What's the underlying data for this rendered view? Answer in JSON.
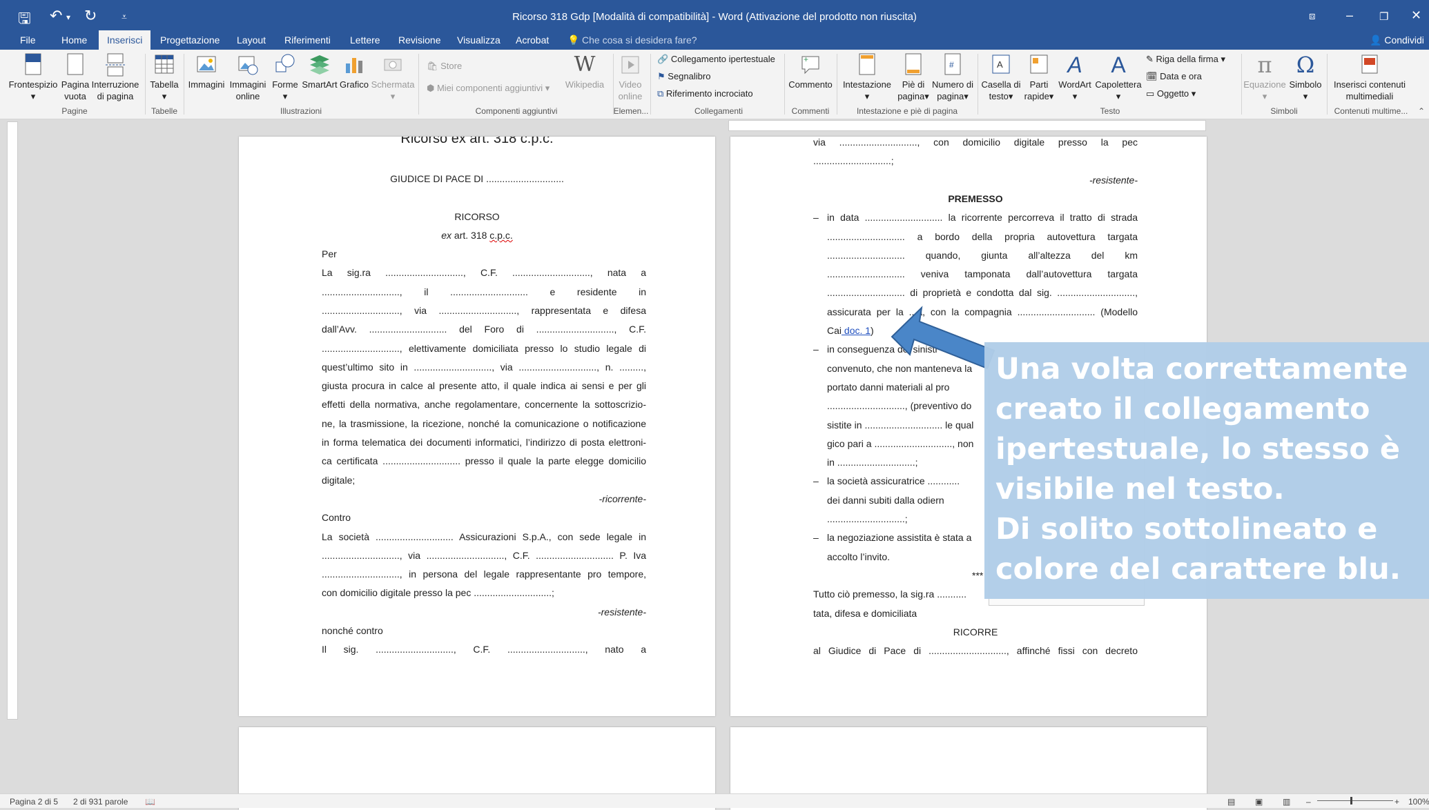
{
  "window": {
    "title": "Ricorso 318 Gdp [Modalità di compatibilità] - Word (Attivazione del prodotto non riuscita)"
  },
  "tabs": [
    "File",
    "Home",
    "Inserisci",
    "Progettazione",
    "Layout",
    "Riferimenti",
    "Lettere",
    "Revisione",
    "Visualizza",
    "Acrobat"
  ],
  "tell_me": "Che cosa si desidera fare?",
  "share": "Condividi",
  "ribbon": {
    "pages": {
      "frontespizio": "Frontespizio",
      "pagina_vuota_1": "Pagina",
      "pagina_vuota_2": "vuota",
      "interruzione_1": "Interruzione",
      "interruzione_2": "di pagina",
      "group": "Pagine"
    },
    "tables": {
      "tabella": "Tabella",
      "group": "Tabelle"
    },
    "illustrations": {
      "immagini": "Immagini",
      "immagini_online_1": "Immagini",
      "immagini_online_2": "online",
      "forme": "Forme",
      "smartart": "SmartArt",
      "grafico": "Grafico",
      "schermata": "Schermata",
      "group": "Illustrazioni"
    },
    "addins": {
      "store": "Store",
      "miei": "Miei componenti aggiuntivi",
      "wikipedia": "Wikipedia",
      "group": "Componenti aggiuntivi"
    },
    "media": {
      "video_1": "Video",
      "video_2": "online",
      "group": "Elemen..."
    },
    "links": {
      "collegamento": "Collegamento ipertestuale",
      "segnalibro": "Segnalibro",
      "riferimento": "Riferimento incrociato",
      "group": "Collegamenti"
    },
    "comments": {
      "commento": "Commento",
      "group": "Commenti"
    },
    "header_footer": {
      "intestazione": "Intestazione",
      "pie_1": "Piè di",
      "pie_2": "pagina",
      "numero_1": "Numero di",
      "numero_2": "pagina",
      "group": "Intestazione e piè di pagina"
    },
    "text": {
      "casella_1": "Casella di",
      "casella_2": "testo",
      "parti_1": "Parti",
      "parti_2": "rapide",
      "wordart": "WordArt",
      "capolettera": "Capolettera",
      "riga_firma": "Riga della firma",
      "data_ora": "Data e ora",
      "oggetto": "Oggetto",
      "group": "Testo"
    },
    "symbols": {
      "equazione": "Equazione",
      "simbolo": "Simbolo",
      "group": "Simboli"
    },
    "multimedia": {
      "inserisci_1": "Inserisci contenuti",
      "inserisci_2": "multimediali",
      "group": "Contenuti multime..."
    }
  },
  "page_left": {
    "heading_cut": "Ricorso ex art. 318 c.p.c.",
    "giudice": "GIUDICE DI PACE DI .............................",
    "ricorso": "RICORSO",
    "ex_art_italic": "ex",
    "ex_art_rest": " art. 318 ",
    "ex_art_cpc": "c.p.c.",
    "lines": [
      {
        "t": "Per",
        "a": "l"
      },
      {
        "t": "La sig.ra ............................., C.F. ............................., nata a",
        "a": "j"
      },
      {
        "t": "............................., il ............................. e residente in",
        "a": "j"
      },
      {
        "t": "............................., via ............................., rappresentata e difesa",
        "a": "j"
      },
      {
        "t": "dall’Avv. ............................. del Foro di ............................., C.F.",
        "a": "j"
      },
      {
        "t": "............................., elettivamente domiciliata presso lo studio legale di",
        "a": "j"
      },
      {
        "t": "quest’ultimo sito in ............................., via ............................., n. .........,",
        "a": "j"
      },
      {
        "t": "giusta procura in calce al presente atto, il quale indica ai sensi e per gli",
        "a": "j"
      },
      {
        "t": "effetti della normativa, anche regolamentare, concernente la sottoscrizio-",
        "a": "j"
      },
      {
        "t": "ne, la trasmissione, la ricezione, nonché la comunicazione o notificazione",
        "a": "j"
      },
      {
        "t": "in forma telematica dei documenti informatici, l’indirizzo di posta elettroni-",
        "a": "j"
      },
      {
        "t": "ca certificata ............................. presso il quale la parte elegge domicilio",
        "a": "j"
      },
      {
        "t": "digitale;",
        "a": "l"
      },
      {
        "t": "-ricorrente-",
        "a": "r",
        "i": true
      },
      {
        "t": "Contro",
        "a": "l"
      },
      {
        "t": "La società ............................. Assicurazioni S.p.A., con sede legale in",
        "a": "j"
      },
      {
        "t": "............................., via ............................., C.F. ............................. P. Iva",
        "a": "j"
      },
      {
        "t": "............................., in persona del legale rappresentante pro tempore,",
        "a": "j"
      },
      {
        "t": "con domicilio digitale presso la pec .............................;",
        "a": "l"
      },
      {
        "t": "-resistente-",
        "a": "r",
        "i": true
      },
      {
        "t": "nonché contro",
        "a": "l"
      },
      {
        "t": "Il sig. ............................., C.F. ............................., nato a",
        "a": "j"
      }
    ]
  },
  "page_right": {
    "lines": [
      {
        "t": "via ............................., con domicilio digitale presso la pec",
        "a": "j",
        "x": 0
      },
      {
        "t": ".............................;",
        "a": "l",
        "x": 0
      },
      {
        "t": "-resistente-",
        "a": "r",
        "x": 0,
        "i": true
      },
      {
        "t": "PREMESSO",
        "a": "c",
        "x": 0,
        "b": true
      },
      {
        "t": "in data ............................. la ricorrente percorreva il tratto di strada",
        "a": "j",
        "x": 20,
        "dash": true
      },
      {
        "t": "............................. a bordo della propria autovettura targata",
        "a": "j",
        "x": 20
      },
      {
        "t": "............................. quando, giunta all’altezza del km",
        "a": "j",
        "x": 20
      },
      {
        "t": "............................. veniva tamponata dall’autovettura targata",
        "a": "j",
        "x": 20
      },
      {
        "t": "............................. di proprietà e condotta dal sig. .............................,",
        "a": "j",
        "x": 20
      },
      {
        "t": "assicurata per la ...a, con la compagnia ............................. (Modello",
        "a": "j",
        "x": 20
      },
      {
        "t": "Cai",
        "a": "l",
        "x": 20,
        "link": "doc. 1",
        "after": ")"
      },
      {
        "t": "in conseguenza del sinistr",
        "a": "l",
        "x": 20,
        "dash": true
      },
      {
        "t": "convenuto, che non manteneva la",
        "a": "l",
        "x": 20
      },
      {
        "t": "portato danni materiali al pro",
        "a": "l",
        "x": 20
      },
      {
        "t": "............................., (preventivo do",
        "a": "l",
        "x": 20
      },
      {
        "t": "sistite in ............................. le qual",
        "a": "l",
        "x": 20
      },
      {
        "t": "gico pari a ............................., non",
        "a": "l",
        "x": 20
      },
      {
        "t": "in .............................;",
        "a": "l",
        "x": 20
      },
      {
        "t": "la società assicuratrice ............",
        "a": "l",
        "x": 20,
        "dash": true
      },
      {
        "t": "dei danni subiti dalla odiern",
        "a": "l",
        "x": 20
      },
      {
        "t": ".............................;",
        "a": "l",
        "x": 20
      },
      {
        "t": "la negoziazione assistita è stata a",
        "a": "l",
        "x": 20,
        "dash": true
      },
      {
        "t": "accolto l’invito.",
        "a": "l",
        "x": 20
      },
      {
        "t": "***",
        "a": "c2",
        "x": 0
      },
      {
        "t": "Tutto ciò premesso, la sig.ra ...........",
        "a": "l",
        "x": 0
      },
      {
        "t": "tata, difesa e domiciliata",
        "a": "l",
        "x": 0
      },
      {
        "t": "RICORRE",
        "a": "c",
        "x": 0
      },
      {
        "t": "al Giudice di Pace di ............................., affinché fissi con decreto",
        "a": "j",
        "x": 0
      }
    ]
  },
  "callout": {
    "text": "Una volta correttamente creato il collegamento ipertestuale, lo stesso è visibile nel testo.\nDi solito sottolineato e colore del carattere blu."
  },
  "status": {
    "page": "Pagina 2 di 5",
    "words": "2 di 931 parole",
    "zoom": "100%"
  },
  "colors": {
    "word_blue": "#2b579a",
    "link_blue": "#1f4fbf",
    "callout_bg": "#b0cde8",
    "arrow": "#4a86c8"
  }
}
